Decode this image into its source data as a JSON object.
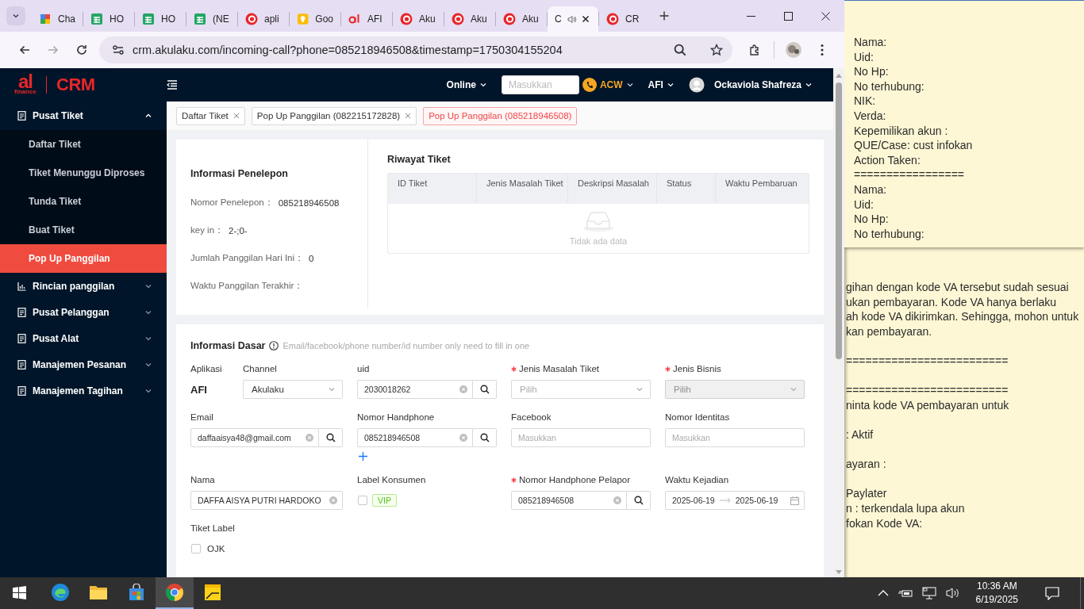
{
  "browser": {
    "tabs": [
      {
        "kind": "colorful",
        "title": "Cha",
        "selected": false,
        "audio": false
      },
      {
        "kind": "sheets",
        "title": "HO",
        "selected": false,
        "audio": false
      },
      {
        "kind": "sheets",
        "title": "HO",
        "selected": false,
        "audio": false
      },
      {
        "kind": "sheets",
        "title": "(NE",
        "selected": false,
        "audio": false
      },
      {
        "kind": "ring",
        "title": "apli",
        "selected": false,
        "audio": false
      },
      {
        "kind": "bulb",
        "title": "Goo",
        "selected": false,
        "audio": false
      },
      {
        "kind": "brand",
        "title": "AFI",
        "selected": false,
        "audio": false
      },
      {
        "kind": "ring",
        "title": "Aku",
        "selected": false,
        "audio": false
      },
      {
        "kind": "ring",
        "title": "Aku",
        "selected": false,
        "audio": false
      },
      {
        "kind": "ring",
        "title": "Aku",
        "selected": false,
        "audio": false
      },
      {
        "title": "C",
        "selected": true,
        "audio": true
      },
      {
        "kind": "ring",
        "title": "CR",
        "selected": false,
        "audio": false
      }
    ],
    "url": "crm.akulaku.com/incoming-call?phone=085218946508&timestamp=1750304155204"
  },
  "crm": {
    "logo": {
      "mark": "al",
      "sub": "finance",
      "name": "CRM"
    },
    "header": {
      "status": "Online",
      "search_placeholder": "Masukkan",
      "call_state": "ACW",
      "product": "AFI",
      "user": "Ockaviola Shafreza"
    },
    "sidebar": [
      {
        "label": "Pusat Tiket",
        "kind": "doc",
        "expanded": true,
        "children": [
          {
            "label": "Daftar Tiket",
            "selected": false
          },
          {
            "label": "Tiket Menunggu Diproses",
            "selected": false
          },
          {
            "label": "Tunda Tiket",
            "selected": false
          },
          {
            "label": "Buat Tiket",
            "selected": false
          },
          {
            "label": "Pop Up Panggilan",
            "selected": true
          }
        ]
      },
      {
        "label": "Rincian panggilan",
        "kind": "chart",
        "expanded": false
      },
      {
        "label": "Pusat Pelanggan",
        "kind": "doc",
        "expanded": false
      },
      {
        "label": "Pusat Alat",
        "kind": "doc",
        "expanded": false
      },
      {
        "label": "Manajemen Pesanan",
        "kind": "doc",
        "expanded": false
      },
      {
        "label": "Manajemen Tagihan",
        "kind": "doc",
        "expanded": false
      }
    ],
    "page_tabs": [
      {
        "label": "Daftar Tiket",
        "selected": false
      },
      {
        "label": "Pop Up Panggilan (082215172828)",
        "selected": false
      },
      {
        "label": "Pop Up Panggilan (085218946508)",
        "selected": true
      }
    ],
    "caller": {
      "title": "Informasi Penelepon",
      "fields": [
        {
          "label": "Nomor Penelepon：",
          "value": "085218946508"
        },
        {
          "label": "key in：",
          "value": "2-;0-"
        },
        {
          "label": "Jumlah Panggilan Hari Ini：",
          "value": "0"
        },
        {
          "label": "Waktu Panggilan Terakhir："
        }
      ]
    },
    "history": {
      "title": "Riwayat Tiket",
      "columns": [
        "ID Tiket",
        "Jenis Masalah Tiket",
        "Deskripsi Masalah",
        "Status",
        "Waktu Pembaruan"
      ],
      "empty_text": "Tidak ada data"
    },
    "basic": {
      "title": "Informasi Dasar",
      "hint": "Email/facebook/phone number/id number only need to fill in one",
      "rows": [
        [
          [
            {
              "kind": "static",
              "label": "Aplikasi",
              "value": "AFI"
            },
            {
              "kind": "select",
              "label": "Channel",
              "value": "Akulaku"
            }
          ],
          [
            {
              "kind": "search",
              "label": "uid",
              "value": "2030018262",
              "clearable": true
            }
          ],
          [
            {
              "kind": "select",
              "label": "Jenis Masalah Tiket",
              "placeholder": "Pilih",
              "required": true,
              "disabled": false
            }
          ],
          [
            {
              "kind": "select",
              "label": "Jenis Bisnis",
              "placeholder": "Pilih",
              "required": true,
              "disabled": true
            }
          ]
        ],
        [
          [
            {
              "kind": "search",
              "label": "Email",
              "value": "daffaaisya48@gmail.com",
              "clearable": true
            }
          ],
          [
            {
              "kind": "search",
              "label": "Nomor Handphone",
              "value": "085218946508",
              "clearable": true,
              "addable": true
            }
          ],
          [
            {
              "kind": "input",
              "label": "Facebook",
              "placeholder": "Masukkan"
            }
          ],
          [
            {
              "kind": "input",
              "label": "Nomor Identitas",
              "placeholder": "Masukkan"
            }
          ]
        ],
        [
          [
            {
              "kind": "input",
              "label": "Nama",
              "value": "DAFFA AISYA PUTRI HARDOKO",
              "clearable": true
            }
          ],
          [
            {
              "kind": "tag-check",
              "label": "Label Konsumen",
              "tag": "VIP",
              "checked": false
            }
          ],
          [
            {
              "kind": "search",
              "label": "Nomor Handphone Pelapor",
              "value": "085218946508",
              "clearable": true,
              "required": true
            }
          ],
          [
            {
              "kind": "daterange",
              "label": "Waktu Kejadian",
              "start": "2025-06-19",
              "end": "2025-06-19"
            }
          ]
        ],
        [
          [
            {
              "kind": "checkbox",
              "label": "Tiket Label",
              "option": "OJK",
              "checked": false
            }
          ]
        ]
      ]
    }
  },
  "sticky_note_front": {
    "lines": [
      "Nama:",
      "Uid:",
      "No Hp:",
      "No terhubung:",
      "NIK:",
      "Verda:",
      "Kepemilikan akun :",
      "QUE/Case: cust infokan",
      "Action Taken:",
      "=================",
      "Nama:",
      "Uid:",
      "No Hp:",
      "No terhubung:"
    ]
  },
  "sticky_note_back": {
    "paragraphs": [
      [
        "gihan dengan kode VA tersebut sudah sesuai",
        "ukan pembayaran. Kode VA hanya berlaku",
        "ah kode VA dikirimkan. Sehingga, mohon untuk",
        "kan pembayaran."
      ],
      [
        "========================="
      ],
      [
        "=========================",
        "ninta kode VA pembayaran untuk"
      ],
      [
        ": Aktif"
      ],
      [
        "ayaran :"
      ],
      [
        "Paylater",
        "n : terkendala lupa akun",
        "fokan Kode VA:"
      ]
    ]
  },
  "taskbar": {
    "apps": [
      {
        "kind": "edge",
        "selected": false
      },
      {
        "kind": "folder",
        "selected": false
      },
      {
        "kind": "store",
        "selected": false
      },
      {
        "kind": "chrome",
        "selected": true
      },
      {
        "kind": "notes",
        "selected": false
      }
    ],
    "time": "10:36 AM",
    "date": "6/19/2025"
  }
}
